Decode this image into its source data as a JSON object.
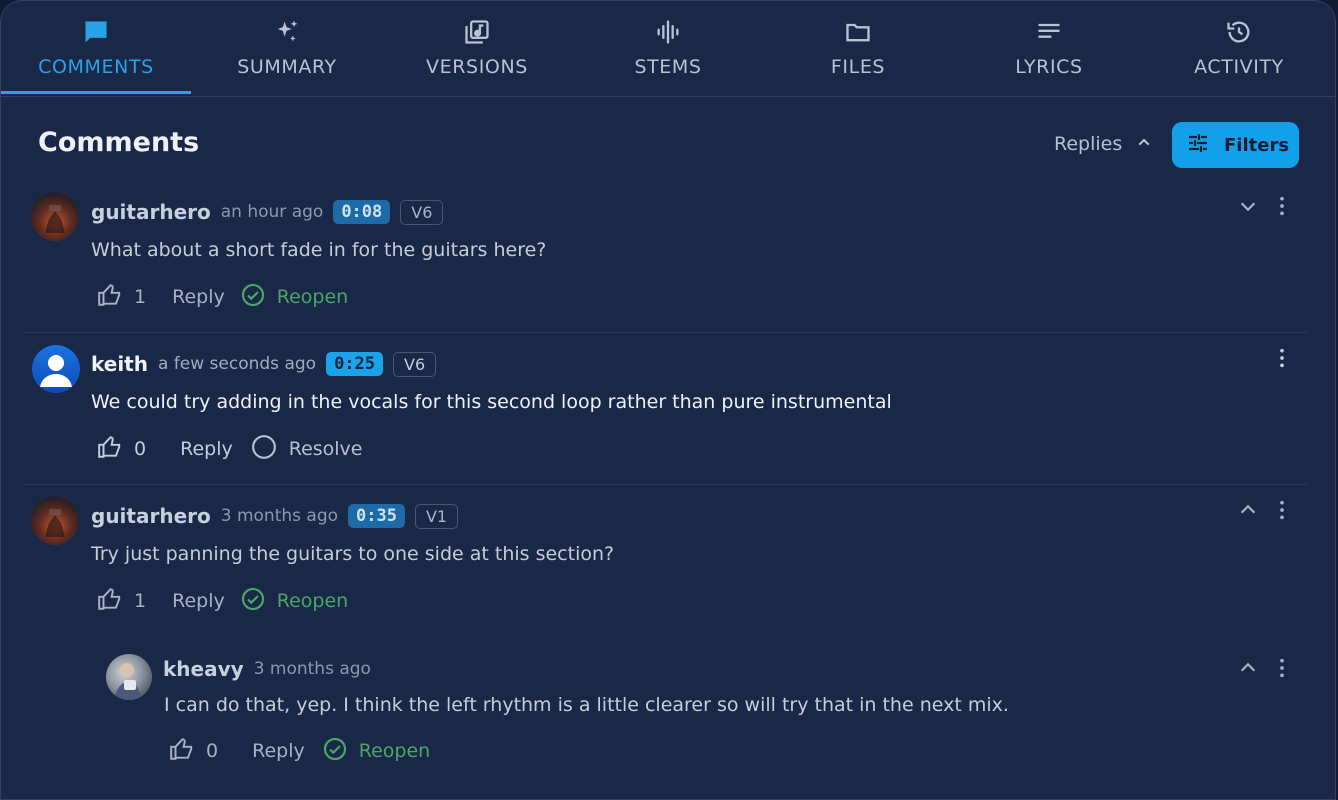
{
  "tabs": [
    {
      "label": "COMMENTS",
      "icon": "comment-icon"
    },
    {
      "label": "SUMMARY",
      "icon": "sparkle-icon"
    },
    {
      "label": "VERSIONS",
      "icon": "music-library-icon"
    },
    {
      "label": "STEMS",
      "icon": "waveform-icon"
    },
    {
      "label": "FILES",
      "icon": "folder-icon"
    },
    {
      "label": "LYRICS",
      "icon": "lines-icon"
    },
    {
      "label": "ACTIVITY",
      "icon": "history-icon"
    }
  ],
  "header": {
    "title": "Comments",
    "replies_label": "Replies",
    "filters_label": "Filters"
  },
  "colors": {
    "accent": "#12a0ea",
    "resolved": "#4aa667",
    "background": "#192847"
  },
  "comments": [
    {
      "author": "guitarhero",
      "time": "an hour ago",
      "timestamp": "0:08",
      "version": "V6",
      "text": "What about a short fade in for the guitars here?",
      "likes": "1",
      "reply": "Reply",
      "status": "Reopen"
    },
    {
      "author": "keith",
      "time": "a few seconds ago",
      "timestamp": "0:25",
      "version": "V6",
      "text": "We could try adding in the vocals for this second loop rather than pure instrumental",
      "likes": "0",
      "reply": "Reply",
      "status": "Resolve"
    },
    {
      "author": "guitarhero",
      "time": "3 months ago",
      "timestamp": "0:35",
      "version": "V1",
      "text": "Try just panning the guitars to one side at this section?",
      "likes": "1",
      "reply": "Reply",
      "status": "Reopen"
    }
  ],
  "replies": [
    {
      "author": "kheavy",
      "time": "3 months ago",
      "text": "I can do that, yep. I think the left rhythm is a little clearer so will try that in the next mix.",
      "likes": "0",
      "reply": "Reply",
      "status": "Reopen"
    }
  ]
}
